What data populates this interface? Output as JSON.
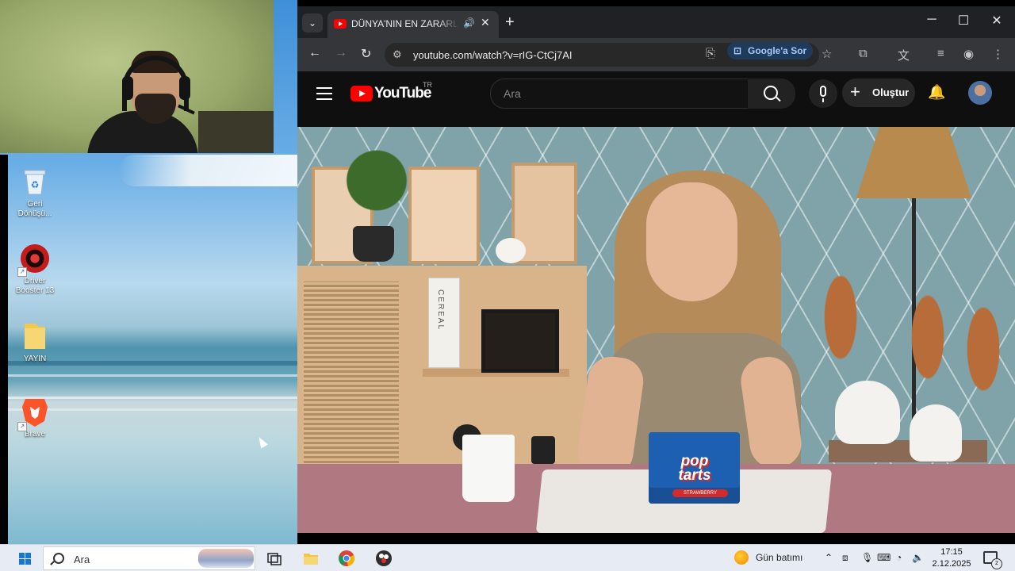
{
  "desktop": {
    "icons": [
      {
        "label": "Geri Dönüşü...",
        "icon": "recycle-bin-icon"
      },
      {
        "label": "Driver Booster 13",
        "icon": "driver-booster-icon"
      },
      {
        "label": "YAYIN",
        "icon": "folder-icon"
      },
      {
        "label": "Brave",
        "icon": "brave-lion-icon"
      }
    ]
  },
  "browser": {
    "tab": {
      "title": "DÜNYA'NIN EN ZARARLI AT",
      "audio_icon": "speaker-icon"
    },
    "window_controls": {
      "minimize": "─",
      "maximize": "☐",
      "close": "✕"
    },
    "address": {
      "url": "youtube.com/watch?v=rIG-CtCj7AI"
    },
    "google_ask_label": "Google'a Sor"
  },
  "youtube": {
    "logo_text": "YouTube",
    "country_code": "TR",
    "search_placeholder": "Ara",
    "create_label": "Oluştur"
  },
  "video": {
    "product_brand": "pop tarts",
    "product_flavor": "STRAWBERRY",
    "book_spine": "CEREAL"
  },
  "taskbar": {
    "search_placeholder": "Ara",
    "weather": "Gün batımı",
    "time": "17:15",
    "date": "2.12.2025",
    "notification_count": "2"
  },
  "colors": {
    "youtube_red": "#ff0000",
    "chrome_dark": "#202124",
    "taskbar_bg": "#e7ebf3",
    "accent_blue": "#a8c7fa"
  }
}
